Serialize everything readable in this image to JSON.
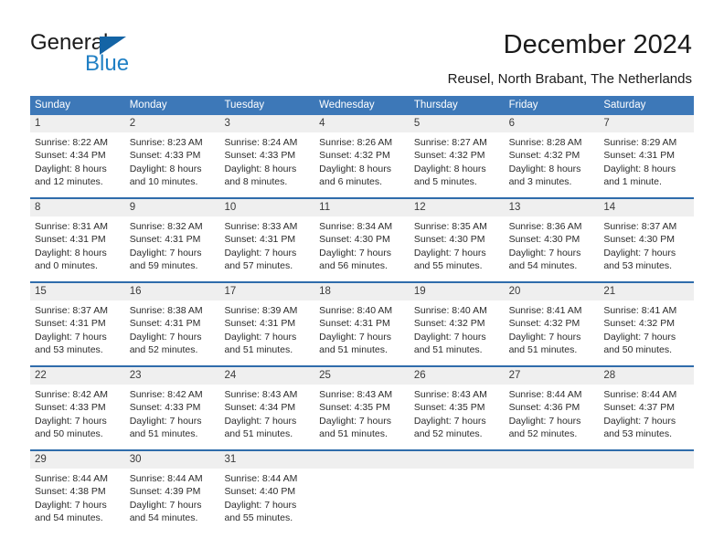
{
  "brand": {
    "name_top": "General",
    "name_bottom": "Blue",
    "triangle_icon": "blue-triangle-icon",
    "color_dark": "#1b1b1b",
    "color_blue": "#1f7fc4"
  },
  "header": {
    "title": "December 2024",
    "subtitle": "Reusel, North Brabant, The Netherlands"
  },
  "theme": {
    "header_blue": "#3d78b8",
    "row_border_blue": "#2f6cab",
    "day_band_gray": "#efefef",
    "text_color": "#2b2b2b"
  },
  "calendar": {
    "weekdays": [
      "Sunday",
      "Monday",
      "Tuesday",
      "Wednesday",
      "Thursday",
      "Friday",
      "Saturday"
    ],
    "weeks": [
      [
        {
          "day": "1",
          "lines": [
            "Sunrise: 8:22 AM",
            "Sunset: 4:34 PM",
            "Daylight: 8 hours",
            "and 12 minutes."
          ]
        },
        {
          "day": "2",
          "lines": [
            "Sunrise: 8:23 AM",
            "Sunset: 4:33 PM",
            "Daylight: 8 hours",
            "and 10 minutes."
          ]
        },
        {
          "day": "3",
          "lines": [
            "Sunrise: 8:24 AM",
            "Sunset: 4:33 PM",
            "Daylight: 8 hours",
            "and 8 minutes."
          ]
        },
        {
          "day": "4",
          "lines": [
            "Sunrise: 8:26 AM",
            "Sunset: 4:32 PM",
            "Daylight: 8 hours",
            "and 6 minutes."
          ]
        },
        {
          "day": "5",
          "lines": [
            "Sunrise: 8:27 AM",
            "Sunset: 4:32 PM",
            "Daylight: 8 hours",
            "and 5 minutes."
          ]
        },
        {
          "day": "6",
          "lines": [
            "Sunrise: 8:28 AM",
            "Sunset: 4:32 PM",
            "Daylight: 8 hours",
            "and 3 minutes."
          ]
        },
        {
          "day": "7",
          "lines": [
            "Sunrise: 8:29 AM",
            "Sunset: 4:31 PM",
            "Daylight: 8 hours",
            "and 1 minute."
          ]
        }
      ],
      [
        {
          "day": "8",
          "lines": [
            "Sunrise: 8:31 AM",
            "Sunset: 4:31 PM",
            "Daylight: 8 hours",
            "and 0 minutes."
          ]
        },
        {
          "day": "9",
          "lines": [
            "Sunrise: 8:32 AM",
            "Sunset: 4:31 PM",
            "Daylight: 7 hours",
            "and 59 minutes."
          ]
        },
        {
          "day": "10",
          "lines": [
            "Sunrise: 8:33 AM",
            "Sunset: 4:31 PM",
            "Daylight: 7 hours",
            "and 57 minutes."
          ]
        },
        {
          "day": "11",
          "lines": [
            "Sunrise: 8:34 AM",
            "Sunset: 4:30 PM",
            "Daylight: 7 hours",
            "and 56 minutes."
          ]
        },
        {
          "day": "12",
          "lines": [
            "Sunrise: 8:35 AM",
            "Sunset: 4:30 PM",
            "Daylight: 7 hours",
            "and 55 minutes."
          ]
        },
        {
          "day": "13",
          "lines": [
            "Sunrise: 8:36 AM",
            "Sunset: 4:30 PM",
            "Daylight: 7 hours",
            "and 54 minutes."
          ]
        },
        {
          "day": "14",
          "lines": [
            "Sunrise: 8:37 AM",
            "Sunset: 4:30 PM",
            "Daylight: 7 hours",
            "and 53 minutes."
          ]
        }
      ],
      [
        {
          "day": "15",
          "lines": [
            "Sunrise: 8:37 AM",
            "Sunset: 4:31 PM",
            "Daylight: 7 hours",
            "and 53 minutes."
          ]
        },
        {
          "day": "16",
          "lines": [
            "Sunrise: 8:38 AM",
            "Sunset: 4:31 PM",
            "Daylight: 7 hours",
            "and 52 minutes."
          ]
        },
        {
          "day": "17",
          "lines": [
            "Sunrise: 8:39 AM",
            "Sunset: 4:31 PM",
            "Daylight: 7 hours",
            "and 51 minutes."
          ]
        },
        {
          "day": "18",
          "lines": [
            "Sunrise: 8:40 AM",
            "Sunset: 4:31 PM",
            "Daylight: 7 hours",
            "and 51 minutes."
          ]
        },
        {
          "day": "19",
          "lines": [
            "Sunrise: 8:40 AM",
            "Sunset: 4:32 PM",
            "Daylight: 7 hours",
            "and 51 minutes."
          ]
        },
        {
          "day": "20",
          "lines": [
            "Sunrise: 8:41 AM",
            "Sunset: 4:32 PM",
            "Daylight: 7 hours",
            "and 51 minutes."
          ]
        },
        {
          "day": "21",
          "lines": [
            "Sunrise: 8:41 AM",
            "Sunset: 4:32 PM",
            "Daylight: 7 hours",
            "and 50 minutes."
          ]
        }
      ],
      [
        {
          "day": "22",
          "lines": [
            "Sunrise: 8:42 AM",
            "Sunset: 4:33 PM",
            "Daylight: 7 hours",
            "and 50 minutes."
          ]
        },
        {
          "day": "23",
          "lines": [
            "Sunrise: 8:42 AM",
            "Sunset: 4:33 PM",
            "Daylight: 7 hours",
            "and 51 minutes."
          ]
        },
        {
          "day": "24",
          "lines": [
            "Sunrise: 8:43 AM",
            "Sunset: 4:34 PM",
            "Daylight: 7 hours",
            "and 51 minutes."
          ]
        },
        {
          "day": "25",
          "lines": [
            "Sunrise: 8:43 AM",
            "Sunset: 4:35 PM",
            "Daylight: 7 hours",
            "and 51 minutes."
          ]
        },
        {
          "day": "26",
          "lines": [
            "Sunrise: 8:43 AM",
            "Sunset: 4:35 PM",
            "Daylight: 7 hours",
            "and 52 minutes."
          ]
        },
        {
          "day": "27",
          "lines": [
            "Sunrise: 8:44 AM",
            "Sunset: 4:36 PM",
            "Daylight: 7 hours",
            "and 52 minutes."
          ]
        },
        {
          "day": "28",
          "lines": [
            "Sunrise: 8:44 AM",
            "Sunset: 4:37 PM",
            "Daylight: 7 hours",
            "and 53 minutes."
          ]
        }
      ],
      [
        {
          "day": "29",
          "lines": [
            "Sunrise: 8:44 AM",
            "Sunset: 4:38 PM",
            "Daylight: 7 hours",
            "and 54 minutes."
          ]
        },
        {
          "day": "30",
          "lines": [
            "Sunrise: 8:44 AM",
            "Sunset: 4:39 PM",
            "Daylight: 7 hours",
            "and 54 minutes."
          ]
        },
        {
          "day": "31",
          "lines": [
            "Sunrise: 8:44 AM",
            "Sunset: 4:40 PM",
            "Daylight: 7 hours",
            "and 55 minutes."
          ]
        },
        {
          "day": "",
          "lines": []
        },
        {
          "day": "",
          "lines": []
        },
        {
          "day": "",
          "lines": []
        },
        {
          "day": "",
          "lines": []
        }
      ]
    ]
  }
}
